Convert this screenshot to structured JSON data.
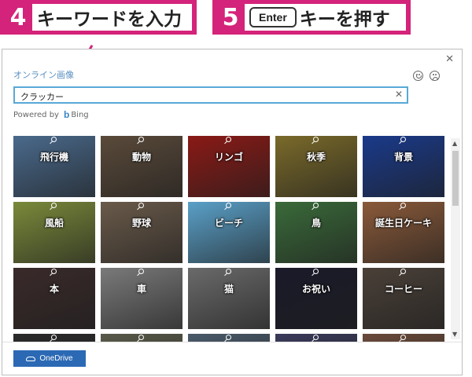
{
  "callouts": {
    "step4": {
      "number": "4",
      "text": "キーワードを入力"
    },
    "step5": {
      "number": "5",
      "key": "Enter",
      "text": "キーを押す"
    }
  },
  "dialog": {
    "title": "オンライン画像",
    "close_icon": "close-icon",
    "feedback_icons": [
      "smile-icon",
      "frown-icon"
    ]
  },
  "search": {
    "value": "クラッカー",
    "clear_icon": "clear-icon"
  },
  "powered_by": {
    "prefix": "Powered by",
    "brand": "Bing",
    "brand_icon": "b"
  },
  "results": [
    {
      "label": "飛行機",
      "color": "#4a6a8c"
    },
    {
      "label": "動物",
      "color": "#5a4a3a"
    },
    {
      "label": "リンゴ",
      "color": "#8a1a16"
    },
    {
      "label": "秋季",
      "color": "#7a6a2a"
    },
    {
      "label": "背景",
      "color": "#1a3a8a"
    },
    {
      "label": "風船",
      "color": "#7a8a3a"
    },
    {
      "label": "野球",
      "color": "#6a5a4a"
    },
    {
      "label": "ビーチ",
      "color": "#5aa0c8"
    },
    {
      "label": "鳥",
      "color": "#3a6a3a"
    },
    {
      "label": "誕生日ケーキ",
      "color": "#8a5a3a"
    },
    {
      "label": "本",
      "color": "#3a2a2a"
    },
    {
      "label": "車",
      "color": "#7a7a7a"
    },
    {
      "label": "猫",
      "color": "#6a6a6a"
    },
    {
      "label": "お祝い",
      "color": "#1a1a2a"
    },
    {
      "label": "コーヒー",
      "color": "#4a4038"
    },
    {
      "label": "",
      "color": "#2a2a2a"
    },
    {
      "label": "",
      "color": "#5a5a4a"
    },
    {
      "label": "",
      "color": "#4a5a6a"
    },
    {
      "label": "",
      "color": "#3a3a5a"
    },
    {
      "label": "",
      "color": "#6a4a3a"
    }
  ],
  "footer": {
    "onedrive_label": "OneDrive",
    "onedrive_icon": "cloud-icon"
  },
  "colors": {
    "accent": "#d4237a",
    "search_border": "#58a9d6",
    "onedrive": "#2b69b4",
    "title": "#5a8fc0"
  }
}
